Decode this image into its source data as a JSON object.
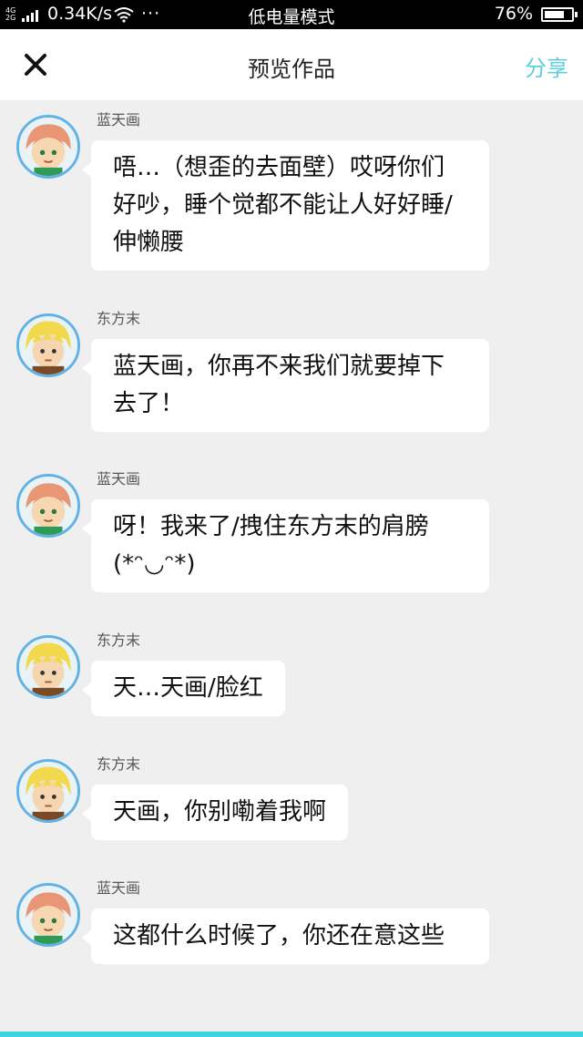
{
  "status_bar": {
    "network": [
      "4G",
      "2G"
    ],
    "speed": "0.34K/s",
    "dots": "···",
    "mode": "低电量模式",
    "battery_text": "76%",
    "battery_level": 0.76,
    "icons": [
      "signal-icon",
      "wifi-icon",
      "battery-icon"
    ]
  },
  "header": {
    "close_icon": "close-icon",
    "title": "预览作品",
    "share": "分享",
    "accent_color": "#5ccfe0"
  },
  "messages": [
    {
      "sender": "蓝天画",
      "text": "唔…（想歪的去面壁）哎呀你们好吵，睡个觉都不能让人好好睡/伸懒腰"
    },
    {
      "sender": "东方末",
      "text": "蓝天画，你再不来我们就要掉下去了！"
    },
    {
      "sender": "蓝天画",
      "text": "呀！我来了/拽住东方末的肩膀(*ᵔ◡ᵔ*)"
    },
    {
      "sender": "东方末",
      "text": "天…天画/脸红"
    },
    {
      "sender": "东方末",
      "text": "天画，你别嘞着我啊"
    },
    {
      "sender": "蓝天画",
      "text": "这都什么时候了，你还在意这些"
    }
  ],
  "colors": {
    "avatar_border": "#62b3e4",
    "background": "#efeff0",
    "bottom_bar": "#3fd3e0"
  }
}
